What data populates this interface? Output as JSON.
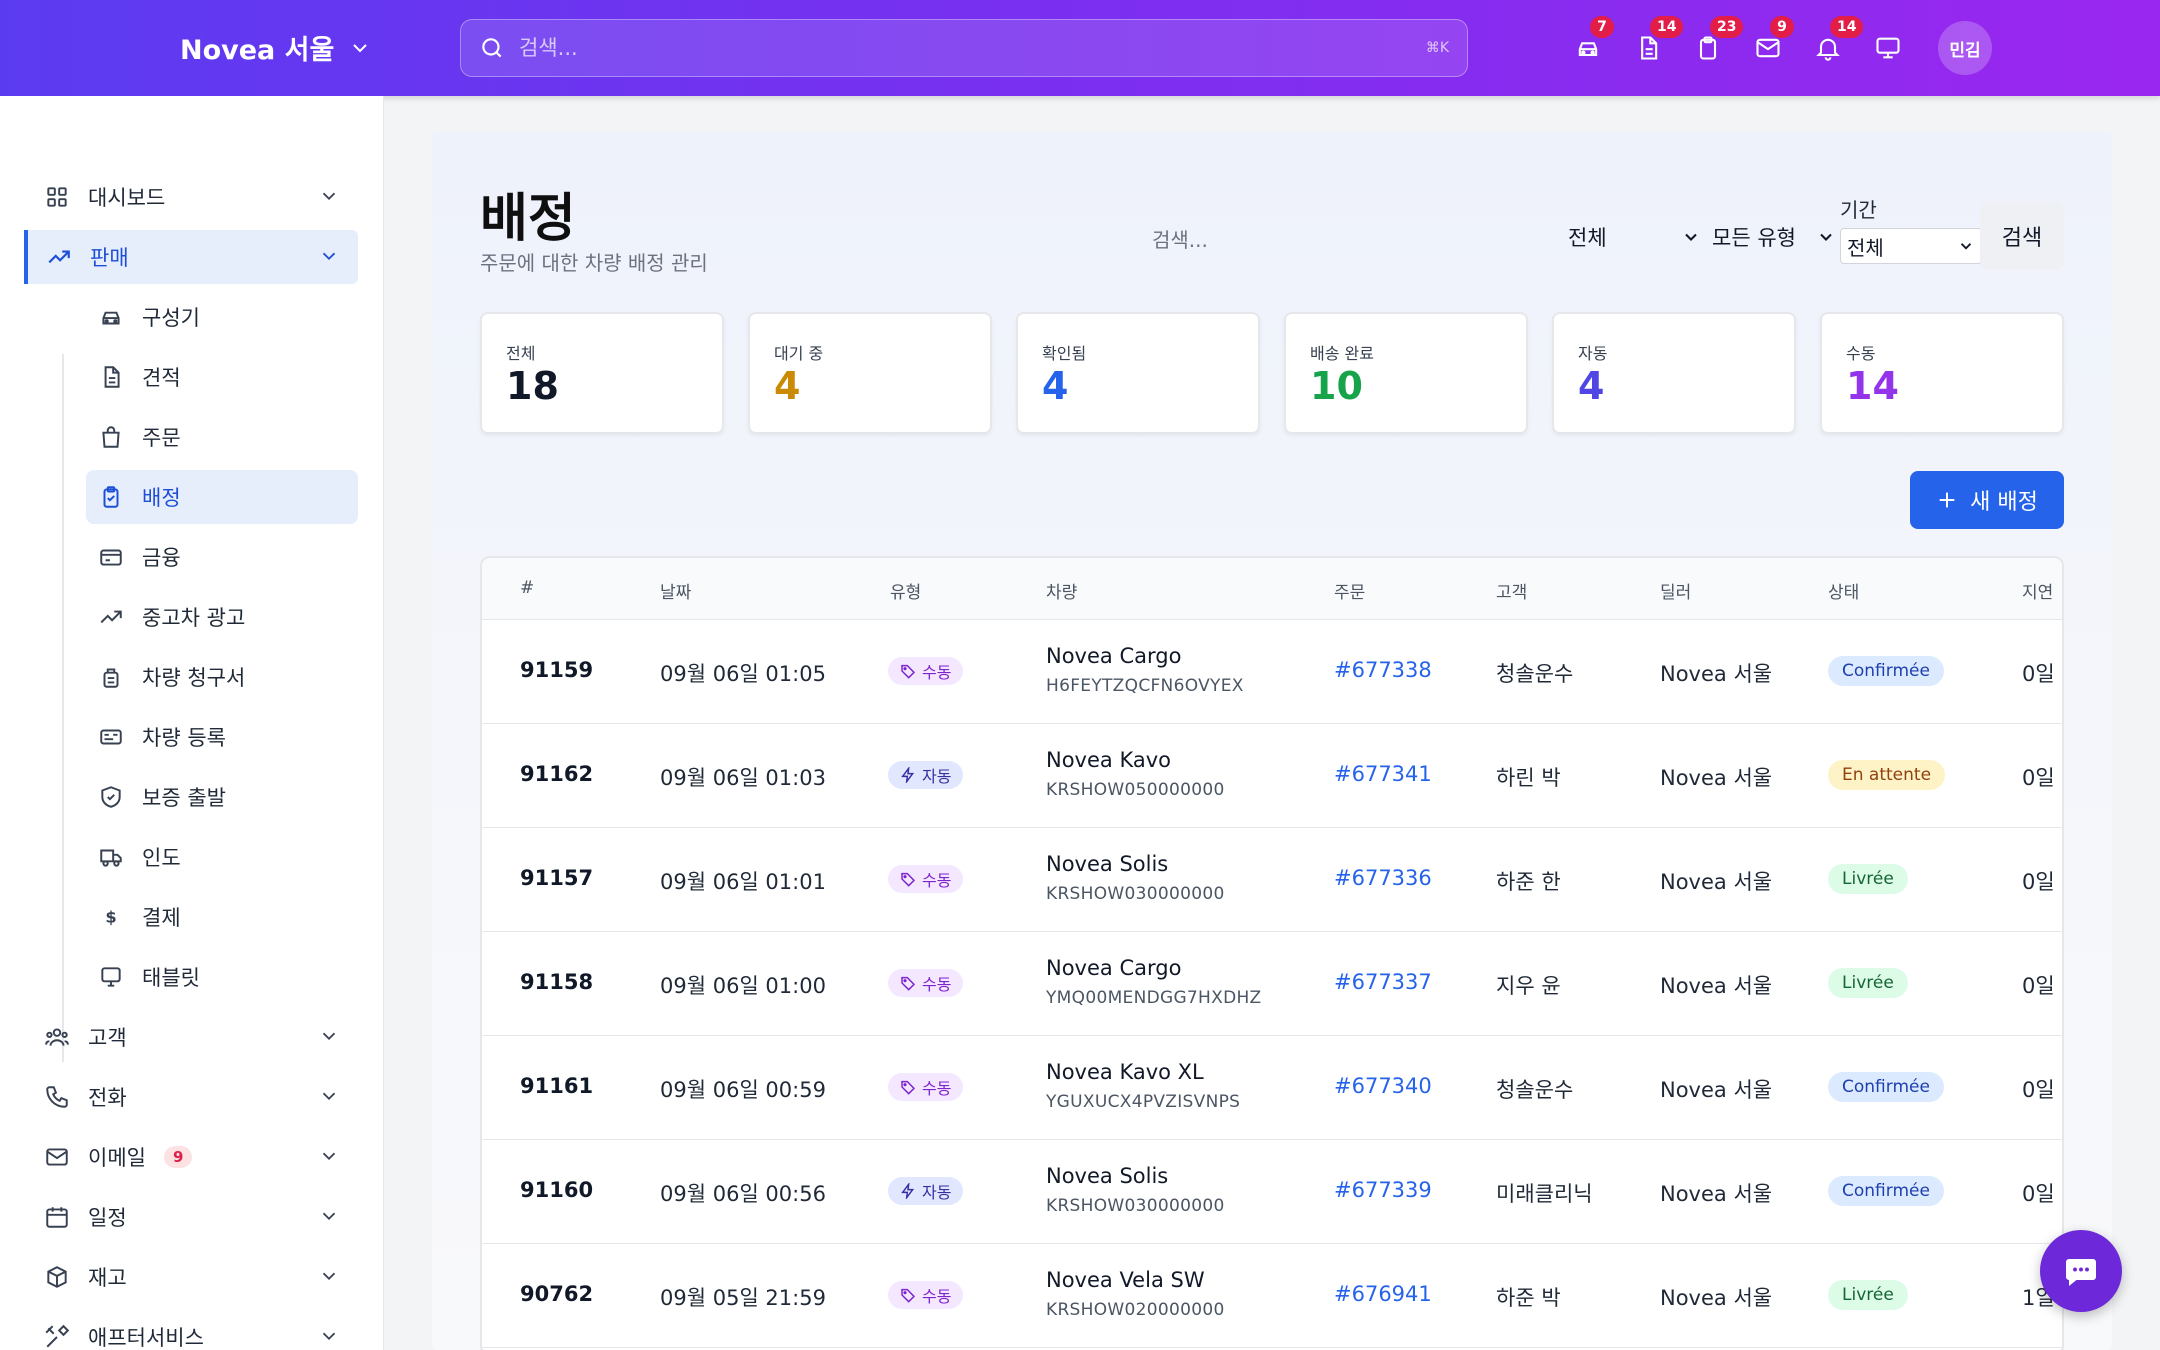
{
  "header": {
    "brand": "Novea 서울",
    "search_placeholder": "검색...",
    "search_shortcut": "⌘K",
    "icons": [
      {
        "name": "car-icon",
        "badge": "7"
      },
      {
        "name": "document-icon",
        "badge": "14"
      },
      {
        "name": "clipboard-icon",
        "badge": "23"
      },
      {
        "name": "mail-icon",
        "badge": "9"
      },
      {
        "name": "bell-icon",
        "badge": "14"
      },
      {
        "name": "monitor-icon",
        "badge": ""
      }
    ],
    "avatar": "민김"
  },
  "sidebar": {
    "dashboard": "대시보드",
    "sales": "판매",
    "sales_items": [
      "구성기",
      "견적",
      "주문",
      "배정",
      "금융",
      "중고차 광고",
      "차량 청구서",
      "차량 등록",
      "보증 출발",
      "인도",
      "결제",
      "태블릿"
    ],
    "customers": "고객",
    "phone": "전화",
    "email": "이메일",
    "email_badge": "9",
    "schedule": "일정",
    "inventory": "재고",
    "after_service": "애프터서비스"
  },
  "page": {
    "title": "배정",
    "subtitle": "주문에 대한 차량 배정 관리",
    "filter_search_placeholder": "검색...",
    "filter_status": "전체",
    "filter_type": "모든 유형",
    "period_label": "기간",
    "period_value": "전체",
    "search_button": "검색",
    "new_button": "새 배정"
  },
  "stats": [
    {
      "label": "전체",
      "value": "18",
      "color": "#111827"
    },
    {
      "label": "대기 중",
      "value": "4",
      "color": "#ca8a04"
    },
    {
      "label": "확인됨",
      "value": "4",
      "color": "#2563eb"
    },
    {
      "label": "배송 완료",
      "value": "10",
      "color": "#16a34a"
    },
    {
      "label": "자동",
      "value": "4",
      "color": "#4f46e5"
    },
    {
      "label": "수동",
      "value": "14",
      "color": "#9333ea"
    }
  ],
  "table": {
    "headers": [
      "#",
      "날짜",
      "유형",
      "차량",
      "주문",
      "고객",
      "딜러",
      "상태",
      "지연"
    ],
    "rows": [
      {
        "id": "91159",
        "date": "09월 06일 01:05",
        "type": "수동",
        "type_kind": "manual",
        "vehicle": "Novea Cargo",
        "vin": "H6FEYTZQCFN6OVYEX",
        "order": "#677338",
        "customer": "청솔운수",
        "dealer": "Novea 서울",
        "status": "Confirmée",
        "status_kind": "confirm",
        "delay": "0일"
      },
      {
        "id": "91162",
        "date": "09월 06일 01:03",
        "type": "자동",
        "type_kind": "auto",
        "vehicle": "Novea Kavo",
        "vin": "KRSHOW050000000",
        "order": "#677341",
        "customer": "하린 박",
        "dealer": "Novea 서울",
        "status": "En attente",
        "status_kind": "wait",
        "delay": "0일"
      },
      {
        "id": "91157",
        "date": "09월 06일 01:01",
        "type": "수동",
        "type_kind": "manual",
        "vehicle": "Novea Solis",
        "vin": "KRSHOW030000000",
        "order": "#677336",
        "customer": "하준 한",
        "dealer": "Novea 서울",
        "status": "Livrée",
        "status_kind": "done",
        "delay": "0일"
      },
      {
        "id": "91158",
        "date": "09월 06일 01:00",
        "type": "수동",
        "type_kind": "manual",
        "vehicle": "Novea Cargo",
        "vin": "YMQ00MENDGG7HXDHZ",
        "order": "#677337",
        "customer": "지우 윤",
        "dealer": "Novea 서울",
        "status": "Livrée",
        "status_kind": "done",
        "delay": "0일"
      },
      {
        "id": "91161",
        "date": "09월 06일 00:59",
        "type": "수동",
        "type_kind": "manual",
        "vehicle": "Novea Kavo XL",
        "vin": "YGUXUCX4PVZISVNPS",
        "order": "#677340",
        "customer": "청솔운수",
        "dealer": "Novea 서울",
        "status": "Confirmée",
        "status_kind": "confirm",
        "delay": "0일"
      },
      {
        "id": "91160",
        "date": "09월 06일 00:56",
        "type": "자동",
        "type_kind": "auto",
        "vehicle": "Novea Solis",
        "vin": "KRSHOW030000000",
        "order": "#677339",
        "customer": "미래클리닉",
        "dealer": "Novea 서울",
        "status": "Confirmée",
        "status_kind": "confirm",
        "delay": "0일"
      },
      {
        "id": "90762",
        "date": "09월 05일 21:59",
        "type": "수동",
        "type_kind": "manual",
        "vehicle": "Novea Vela SW",
        "vin": "KRSHOW020000000",
        "order": "#676941",
        "customer": "하준 박",
        "dealer": "Novea 서울",
        "status": "Livrée",
        "status_kind": "done",
        "delay": "1일"
      }
    ]
  }
}
